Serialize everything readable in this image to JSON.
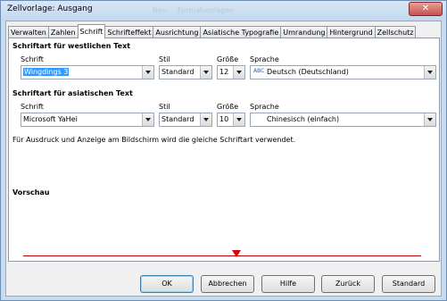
{
  "window": {
    "title": "Zellvorlage: Ausgang",
    "close_glyph": "✕",
    "ghost_text": [
      "Neu",
      "Formatvorlagen"
    ]
  },
  "tabs": [
    "Verwalten",
    "Zahlen",
    "Schrift",
    "Schrifteffekt",
    "Ausrichtung",
    "Asiatische Typografie",
    "Umrandung",
    "Hintergrund",
    "Zellschutz"
  ],
  "active_tab": "Schrift",
  "western": {
    "heading": "Schriftart für westlichen Text",
    "font_label": "Schrift",
    "font_value": "Wingdings 3",
    "style_label": "Stil",
    "style_value": "Standard",
    "size_label": "Größe",
    "size_value": "12",
    "lang_label": "Sprache",
    "lang_value": "Deutsch (Deutschland)",
    "lang_icon": "ABC"
  },
  "asian": {
    "heading": "Schriftart für asiatischen Text",
    "font_label": "Schrift",
    "font_value": "Microsoft YaHei",
    "style_label": "Stil",
    "style_value": "Standard",
    "size_label": "Größe",
    "size_value": "10",
    "lang_label": "Sprache",
    "lang_value": "Chinesisch (einfach)"
  },
  "info": "Für Ausdruck und Anzeige am Bildschirm wird die gleiche Schriftart verwendet.",
  "preview_label": "Vorschau",
  "buttons": {
    "ok": "OK",
    "cancel": "Abbrechen",
    "help": "Hilfe",
    "back": "Zurück",
    "standard": "Standard"
  }
}
